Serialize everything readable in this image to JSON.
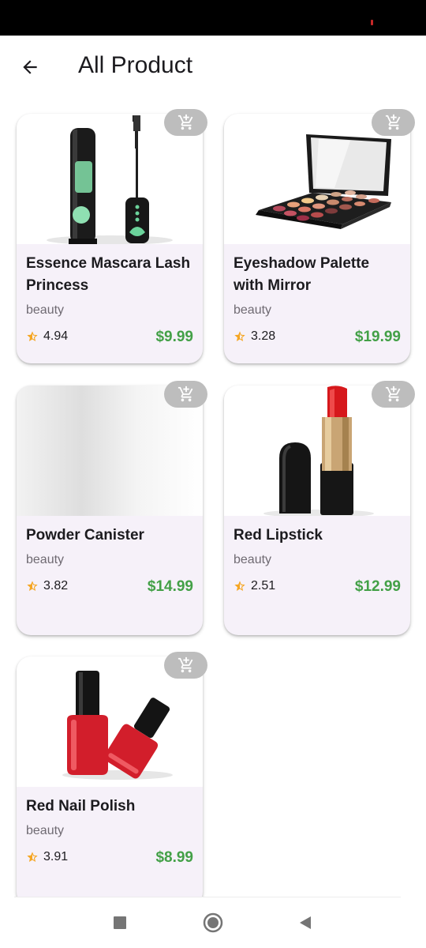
{
  "header": {
    "title": "All Product",
    "back_icon": "arrow-back-icon"
  },
  "products": [
    {
      "name": "Essence Mascara Lash Princess",
      "category": "beauty",
      "rating": "4.94",
      "price": "$9.99"
    },
    {
      "name": "Eyeshadow Palette with Mirror",
      "category": "beauty",
      "rating": "3.28",
      "price": "$19.99"
    },
    {
      "name": "Powder Canister",
      "category": "beauty",
      "rating": "3.82",
      "price": "$14.99"
    },
    {
      "name": "Red Lipstick",
      "category": "beauty",
      "rating": "2.51",
      "price": "$12.99"
    },
    {
      "name": "Red Nail Polish",
      "category": "beauty",
      "rating": "3.91",
      "price": "$8.99"
    }
  ],
  "colors": {
    "price": "#43a047",
    "card_bg": "#f6f1f9",
    "star": "#f5a623",
    "cart_button": "#bdbdbd"
  },
  "icons": {
    "cart": "add-shopping-cart-icon",
    "rating": "star-half-icon",
    "nav": [
      "square-stop-icon",
      "circle-home-icon",
      "triangle-back-icon"
    ]
  }
}
